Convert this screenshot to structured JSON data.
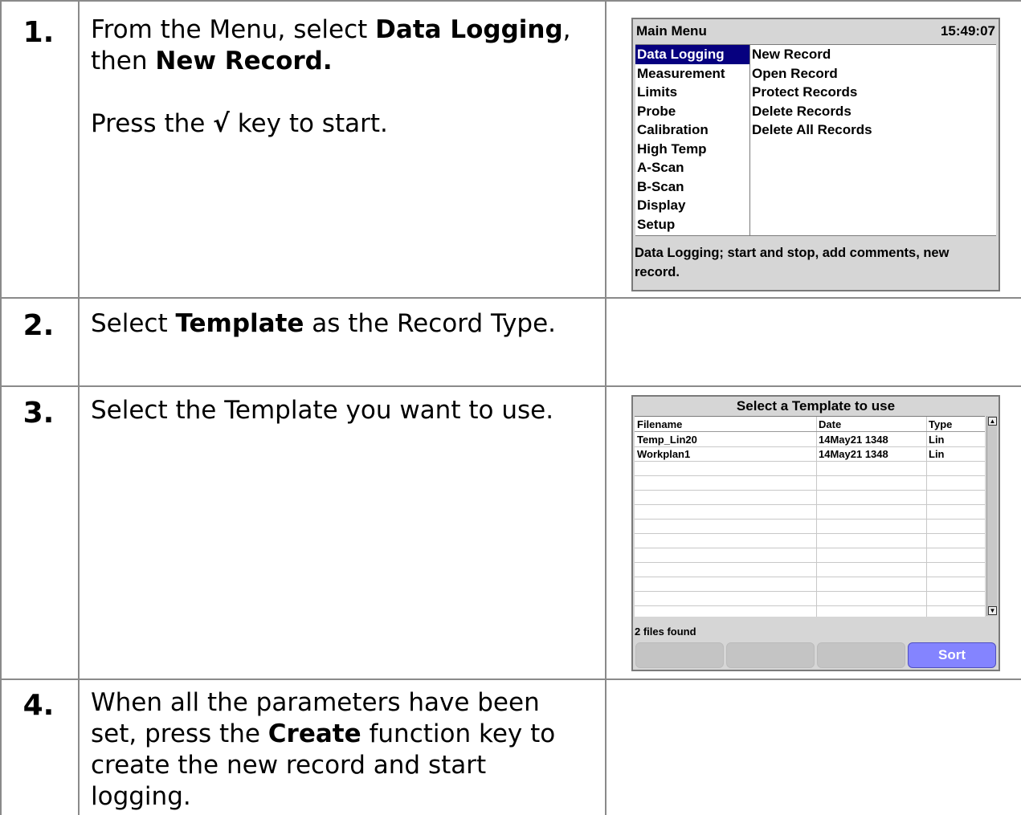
{
  "steps": [
    {
      "number": "1.",
      "text_a": "From the Menu, select ",
      "bold_a": "Data Logging",
      "text_b": ",",
      "text_c": "then ",
      "bold_b": "New Record.",
      "text_d": "Press the ",
      "check_key": "√",
      "text_e": " key to start."
    },
    {
      "number": "2.",
      "text_a": "Select ",
      "bold_a": "Template",
      "text_b": " as the Record Type."
    },
    {
      "number": "3.",
      "text_a": "Select the Template you want to use."
    },
    {
      "number": "4.",
      "line1": "When all the parameters have been",
      "line2a": "set, press the ",
      "bold_a": "Create",
      "line2b": " function key to",
      "line3": "create the new record and start",
      "line4": "logging."
    }
  ],
  "main_menu": {
    "title": "Main Menu",
    "time": "15:49:07",
    "items": [
      "Data Logging",
      "Measurement",
      "Limits",
      "Probe",
      "Calibration",
      "High Temp",
      "A-Scan",
      "B-Scan",
      "Display",
      "Setup"
    ],
    "selected_index": 0,
    "submenu": [
      "New Record",
      "Open Record",
      "Protect Records",
      "Delete Records",
      "Delete All Records"
    ],
    "status": "Data Logging; start and stop, add comments, new record.",
    "selection_color": "#06007f"
  },
  "template_screen": {
    "title": "Select a Template to use",
    "columns": [
      "Filename",
      "Date",
      "Type"
    ],
    "rows": [
      [
        "Temp_Lin20",
        "14May21 1348",
        "Lin"
      ],
      [
        "Workplan1",
        "14May21 1348",
        "Lin"
      ]
    ],
    "status": "2 files found",
    "softkeys": [
      "",
      "",
      "",
      "Sort"
    ],
    "active_key_color": "#8484ff"
  }
}
